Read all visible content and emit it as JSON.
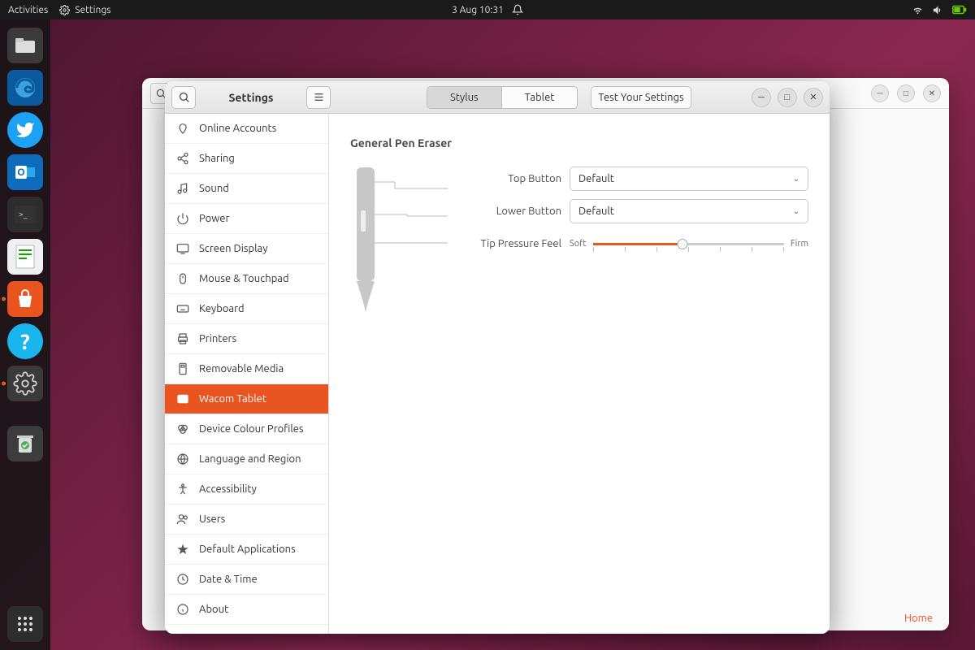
{
  "topbar": {
    "activities": "Activities",
    "app_label": "Settings",
    "datetime": "3 Aug  10:31"
  },
  "bg_window": {
    "home": "Home"
  },
  "settings": {
    "title": "Settings",
    "tabs": {
      "stylus": "Stylus",
      "tablet": "Tablet"
    },
    "test_button": "Test Your Settings",
    "sidebar": [
      {
        "id": "online-accounts",
        "label": "Online Accounts"
      },
      {
        "id": "sharing",
        "label": "Sharing"
      },
      {
        "id": "sound",
        "label": "Sound"
      },
      {
        "id": "power",
        "label": "Power"
      },
      {
        "id": "screen-display",
        "label": "Screen Display"
      },
      {
        "id": "mouse-touchpad",
        "label": "Mouse & Touchpad"
      },
      {
        "id": "keyboard",
        "label": "Keyboard"
      },
      {
        "id": "printers",
        "label": "Printers"
      },
      {
        "id": "removable-media",
        "label": "Removable Media"
      },
      {
        "id": "wacom-tablet",
        "label": "Wacom Tablet",
        "active": true
      },
      {
        "id": "colour-profiles",
        "label": "Device Colour Profiles"
      },
      {
        "id": "language-region",
        "label": "Language and Region"
      },
      {
        "id": "accessibility",
        "label": "Accessibility"
      },
      {
        "id": "users",
        "label": "Users"
      },
      {
        "id": "default-apps",
        "label": "Default Applications"
      },
      {
        "id": "date-time",
        "label": "Date & Time"
      },
      {
        "id": "about",
        "label": "About"
      }
    ],
    "content": {
      "heading": "General Pen Eraser",
      "top_button_label": "Top Button",
      "lower_button_label": "Lower Button",
      "tip_pressure_label": "Tip Pressure Feel",
      "top_button_value": "Default",
      "lower_button_value": "Default",
      "soft": "Soft",
      "firm": "Firm",
      "pressure_percent": 47
    }
  }
}
